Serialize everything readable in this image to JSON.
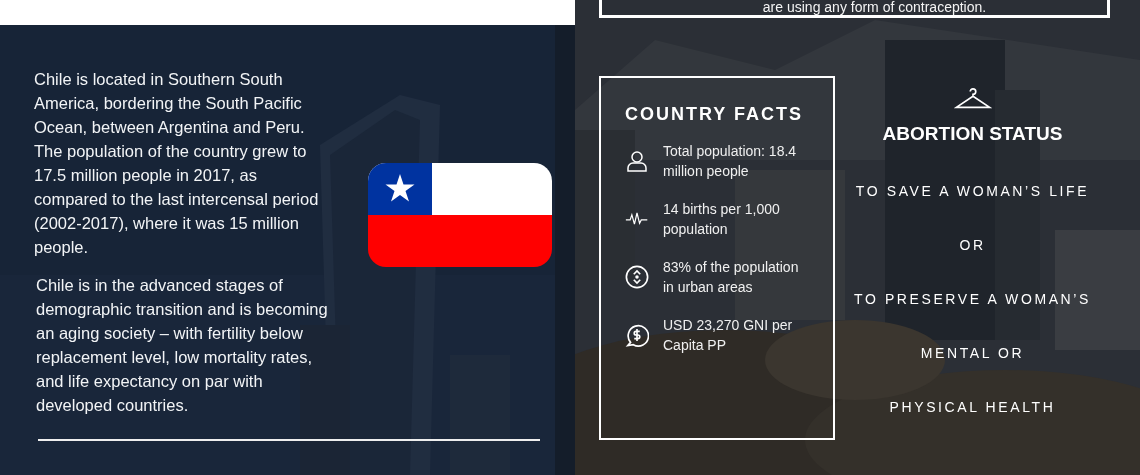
{
  "intro": {
    "paragraphs": [
      "Chile is located in Southern South America, bordering the South Pacific Ocean, between Argentina and Peru. The population of the country grew to 17.5 million people in 2017, as compared to the last intercensal period (2002-2017), where it was 15 million people.",
      "Chile is in the advanced stages of demographic transition and is becoming an aging society – with fertility below replacement level, low mortality rates, and life expectancy on par with developed countries."
    ]
  },
  "contraception_note": {
    "text": "are using any form of contraception."
  },
  "country_facts": {
    "title": "COUNTRY FACTS",
    "items": [
      {
        "kind": "person",
        "text": "Total population: 18.4 million people"
      },
      {
        "kind": "pulse",
        "text": "14 births per 1,000 population"
      },
      {
        "kind": "arrows",
        "text": "83% of the population in urban areas"
      },
      {
        "kind": "money",
        "text": "USD 23,270 GNI per Capita PP"
      }
    ]
  },
  "abortion_status": {
    "title": "ABORTION STATUS",
    "lines": [
      "TO SAVE A WOMAN’S LIFE",
      "OR",
      "TO PRESERVE A WOMAN’S",
      "MENTAL OR",
      "PHYSICAL HEALTH"
    ]
  }
}
